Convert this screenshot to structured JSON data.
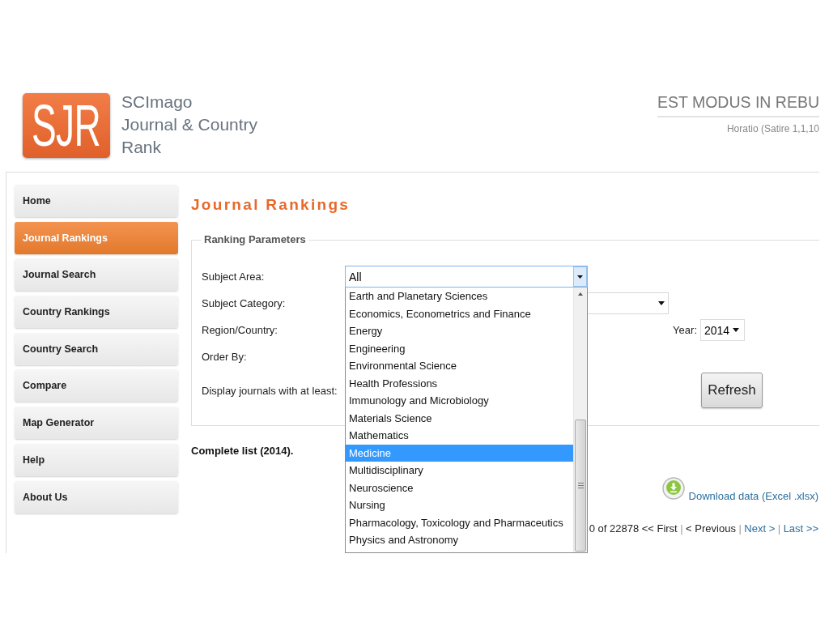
{
  "header": {
    "logo": "SJR",
    "site_name": [
      "SCImago",
      "Journal & Country",
      "Rank"
    ],
    "motto": "EST MODUS IN REBU",
    "attribution": "Horatio (Satire 1,1,10"
  },
  "sidebar": {
    "items": [
      {
        "label": "Home",
        "selected": false
      },
      {
        "label": "Journal Rankings",
        "selected": true
      },
      {
        "label": "Journal Search",
        "selected": false
      },
      {
        "label": "Country Rankings",
        "selected": false
      },
      {
        "label": "Country Search",
        "selected": false
      },
      {
        "label": "Compare",
        "selected": false
      },
      {
        "label": "Map Generator",
        "selected": false
      },
      {
        "label": "Help",
        "selected": false
      },
      {
        "label": "About Us",
        "selected": false
      }
    ]
  },
  "page_title": "Journal Rankings",
  "parameters": {
    "legend": "Ranking Parameters",
    "rows": [
      {
        "label": "Subject Area:",
        "kind": "select",
        "value": "All",
        "open": true,
        "options": [
          {
            "label": "Earth and Planetary Sciences",
            "selected": false
          },
          {
            "label": "Economics, Econometrics and Finance",
            "selected": false
          },
          {
            "label": "Energy",
            "selected": false
          },
          {
            "label": "Engineering",
            "selected": false
          },
          {
            "label": "Environmental Science",
            "selected": false
          },
          {
            "label": "Health Professions",
            "selected": false
          },
          {
            "label": "Immunology and Microbiology",
            "selected": false
          },
          {
            "label": "Materials Science",
            "selected": false
          },
          {
            "label": "Mathematics",
            "selected": false
          },
          {
            "label": "Medicine",
            "selected": true
          },
          {
            "label": "Multidisciplinary",
            "selected": false
          },
          {
            "label": "Neuroscience",
            "selected": false
          },
          {
            "label": "Nursing",
            "selected": false
          },
          {
            "label": "Pharmacology, Toxicology and Pharmaceutics",
            "selected": false
          },
          {
            "label": "Physics and Astronomy",
            "selected": false
          }
        ]
      },
      {
        "label": "Subject Category:",
        "kind": "select",
        "open": false
      },
      {
        "label": "Region/Country:",
        "kind": "label",
        "year": {
          "label": "Year:",
          "value": "2014"
        }
      },
      {
        "label": "Order By:",
        "kind": "label"
      },
      {
        "label": "Display journals with at least:",
        "kind": "label",
        "button": "Refresh"
      }
    ]
  },
  "list_summary": "Complete list (2014).",
  "download": {
    "label": "Download data (Excel .xlsx)"
  },
  "pagination": {
    "summary": "0 of 22878",
    "separator": "|",
    "links": [
      {
        "label": "<< First",
        "disabled": true
      },
      {
        "label": "< Previous",
        "disabled": true
      },
      {
        "label": "Next >",
        "disabled": false
      },
      {
        "label": "Last >>",
        "disabled": false
      }
    ]
  }
}
